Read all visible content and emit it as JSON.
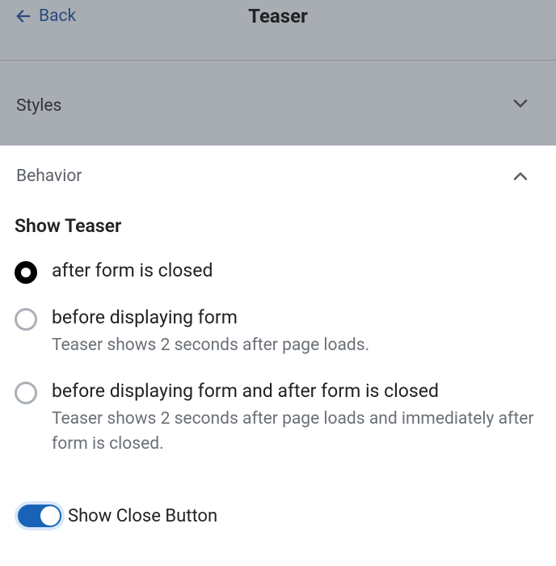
{
  "header": {
    "back_label": "Back",
    "title": "Teaser"
  },
  "sections": {
    "styles": {
      "label": "Styles",
      "expanded": false
    },
    "behavior": {
      "label": "Behavior",
      "expanded": true
    }
  },
  "show_teaser": {
    "title": "Show Teaser",
    "options": [
      {
        "label": "after form is closed",
        "description": "",
        "selected": true
      },
      {
        "label": "before displaying form",
        "description": "Teaser shows 2 seconds after page loads.",
        "selected": false
      },
      {
        "label": "before displaying form and after form is closed",
        "description": "Teaser shows 2 seconds after page loads and immediately after form is closed.",
        "selected": false
      }
    ]
  },
  "show_close_button": {
    "label": "Show Close Button",
    "enabled": true
  }
}
